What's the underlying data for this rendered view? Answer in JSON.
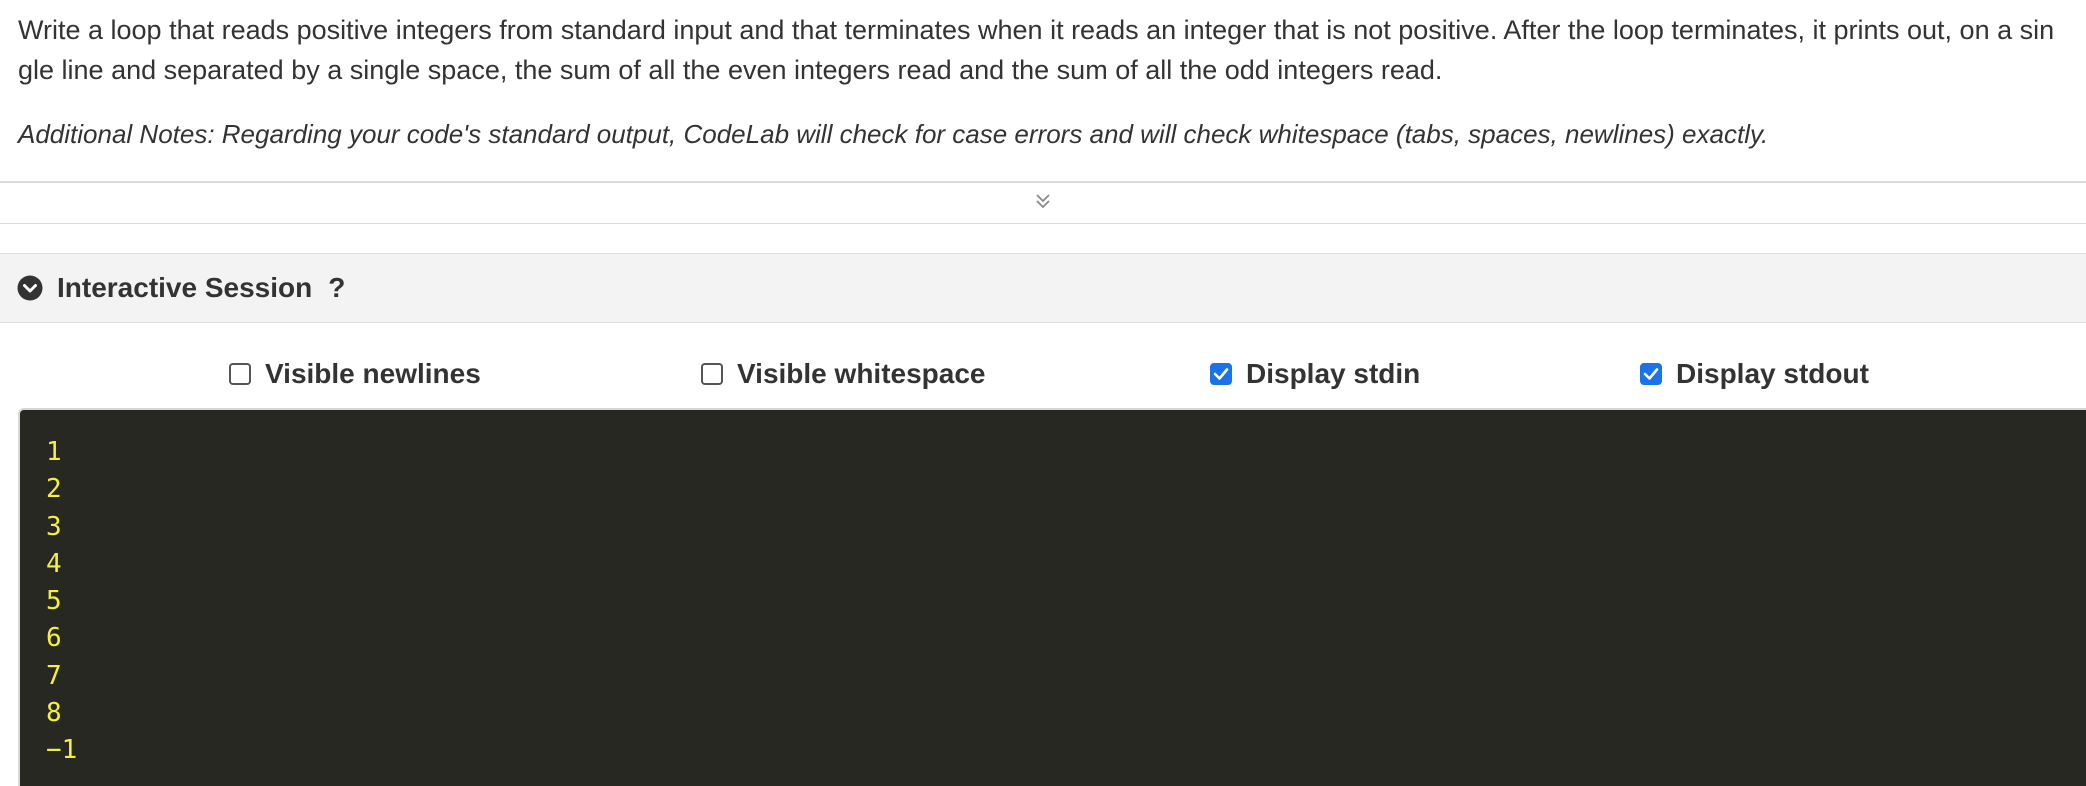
{
  "problem": {
    "text": "Write a loop that reads positive integers from standard input and that terminates when it reads an integer that is not positive. After the loop terminates, it prints out, on a single line and separated by a single space, the sum of all the even integers read and the sum of all the odd integers read.",
    "notes": "Additional Notes: Regarding your code's standard output, CodeLab will check for case errors and will check whitespace (tabs, spaces, newlines) exactly."
  },
  "session": {
    "title": "Interactive Session",
    "help": "?"
  },
  "options": [
    {
      "label": "Visible newlines",
      "checked": false
    },
    {
      "label": "Visible whitespace",
      "checked": false
    },
    {
      "label": "Display stdin",
      "checked": true
    },
    {
      "label": "Display stdout",
      "checked": true
    }
  ],
  "terminal": {
    "lines": [
      "1",
      "2",
      "3",
      "4",
      "5",
      "6",
      "7",
      "8",
      "−1"
    ]
  },
  "colors": {
    "terminal_bg": "#272822",
    "stdin_text": "#f4f03c",
    "checkbox_checked": "#1a73e8",
    "header_bg": "#f3f3f3"
  },
  "icons": {
    "expander": "double-chevron-down-icon",
    "session_toggle": "chevron-circle-down-icon",
    "checkmark": "checkmark-icon"
  }
}
